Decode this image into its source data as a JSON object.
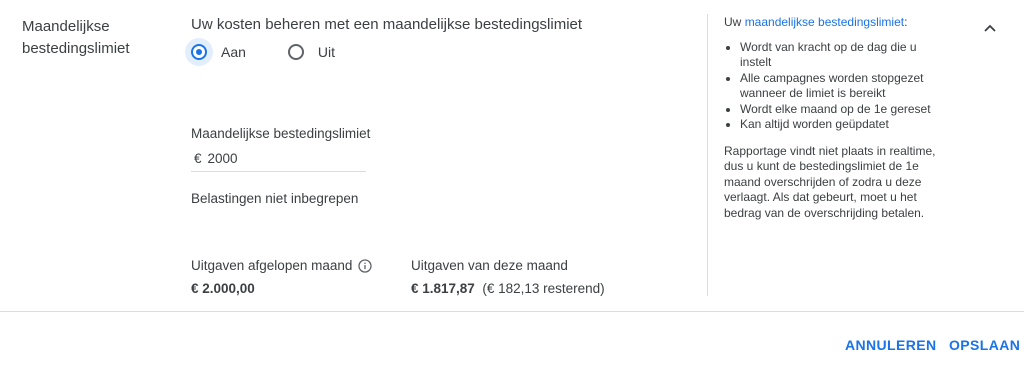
{
  "section": {
    "label": "Maandelijkse bestedingslimiet"
  },
  "heading": "Uw kosten beheren met een maandelijkse bestedingslimiet",
  "radio": {
    "on_label": "Aan",
    "off_label": "Uit",
    "selected": "Aan"
  },
  "limit_field": {
    "label": "Maandelijkse bestedingslimiet",
    "currency": "€",
    "value": "2000"
  },
  "tax_note": "Belastingen niet inbegrepen",
  "spend_last_month": {
    "label": "Uitgaven afgelopen maand",
    "value": "€ 2.000,00",
    "icon": "info-icon"
  },
  "spend_this_month": {
    "label": "Uitgaven van deze maand",
    "value": "€ 1.817,87",
    "remaining": "(€ 182,13 resterend)"
  },
  "help": {
    "intro_prefix": "Uw",
    "intro_link": "maandelijkse bestedingslimiet",
    "intro_suffix": ":",
    "bullets": [
      "Wordt van kracht op de dag die u instelt",
      "Alle campagnes worden stopgezet wanneer de limiet is bereikt",
      "Wordt elke maand op de 1e gereset",
      "Kan altijd worden geüpdatet"
    ],
    "paragraph": "Rapportage vindt niet plaats in realtime, dus u kunt de bestedingslimiet de 1e maand overschrijden of zodra u deze verlaagt. Als dat gebeurt, moet u het bedrag van de overschrijding betalen."
  },
  "actions": {
    "cancel": "ANNULEREN",
    "save": "OPSLAAN"
  },
  "colors": {
    "accent": "#1a73e8",
    "text": "#3c4043",
    "divider": "#dadce0"
  }
}
